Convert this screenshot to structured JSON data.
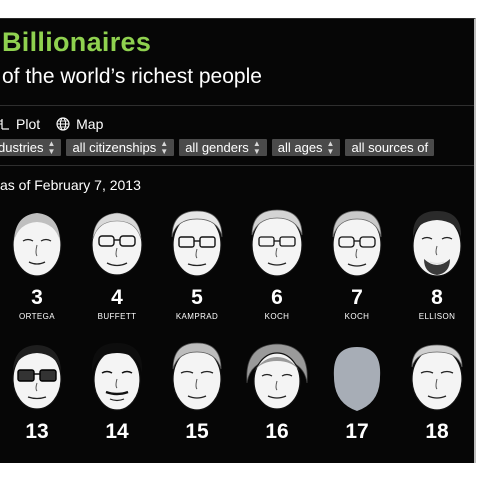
{
  "header": {
    "title": "Billionaires",
    "subtitle": "of the world’s richest people"
  },
  "view_options": {
    "plot_label": "Plot",
    "map_label": "Map"
  },
  "filters": [
    "dustries",
    "all citizenships",
    "all genders",
    "all ages",
    "all sources of"
  ],
  "as_of": "as of February 7, 2013",
  "people_row1": [
    {
      "rank": "3",
      "name": "ORTEGA"
    },
    {
      "rank": "4",
      "name": "BUFFETT"
    },
    {
      "rank": "5",
      "name": "KAMPRAD"
    },
    {
      "rank": "6",
      "name": "KOCH"
    },
    {
      "rank": "7",
      "name": "KOCH"
    },
    {
      "rank": "8",
      "name": "ELLISON"
    }
  ],
  "people_row2": [
    {
      "rank": "13"
    },
    {
      "rank": "14"
    },
    {
      "rank": "15"
    },
    {
      "rank": "16"
    },
    {
      "rank": "17"
    },
    {
      "rank": "18"
    }
  ],
  "colors": {
    "background": "#060606",
    "title_green": "#8fd14f",
    "filter_bg": "#4a4a4a",
    "placeholder_face": "#a7adb6"
  }
}
